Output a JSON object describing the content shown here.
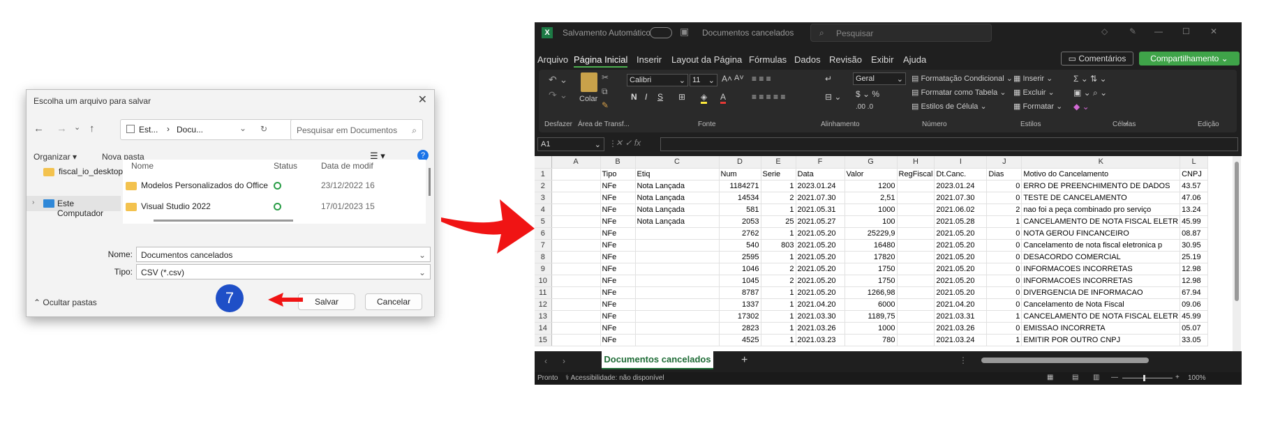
{
  "dialog": {
    "title": "Escolha um arquivo para salvar",
    "address": {
      "part1": "Est...",
      "part2": "Docu..."
    },
    "search_placeholder": "Pesquisar em Documentos",
    "toolbar": {
      "organize": "Organizar",
      "new_folder": "Nova pasta"
    },
    "nav": {
      "item1": "fiscal_io_desktop",
      "item2": "Este Computador"
    },
    "columns": {
      "name": "Nome",
      "status": "Status",
      "date": "Data de modif"
    },
    "files": [
      {
        "name": "Modelos Personalizados do Office",
        "date": "23/12/2022 16"
      },
      {
        "name": "Visual Studio 2022",
        "date": "17/01/2023 15"
      }
    ],
    "name_label": "Nome:",
    "name_value": "Documentos cancelados",
    "type_label": "Tipo:",
    "type_value": "CSV (*.csv)",
    "hide_folders": "Ocultar pastas",
    "save": "Salvar",
    "cancel": "Cancelar",
    "step": "7"
  },
  "excel": {
    "autosave": "Salvamento Automático",
    "doc_title": "Documentos cancelados",
    "search": "Pesquisar",
    "tabs": [
      "Arquivo",
      "Página Inicial",
      "Inserir",
      "Layout da Página",
      "Fórmulas",
      "Dados",
      "Revisão",
      "Exibir",
      "Ajuda"
    ],
    "comments": "Comentários",
    "share": "Compartilhamento",
    "ribbon": {
      "paste": "Colar",
      "font": "Calibri",
      "size": "11",
      "number_format": "Geral",
      "cond_format": "Formatação Condicional",
      "format_table": "Formatar como Tabela",
      "cell_styles": "Estilos de Célula",
      "insert": "Inserir",
      "delete": "Excluir",
      "format": "Formatar"
    },
    "groups": [
      "Desfazer",
      "Área de Transf...",
      "Fonte",
      "Alinhamento",
      "Número",
      "Estilos",
      "Células",
      "Edição"
    ],
    "cellref": "A1",
    "col_letters": [
      "A",
      "B",
      "C",
      "D",
      "E",
      "F",
      "G",
      "H",
      "I",
      "J",
      "K",
      "L"
    ],
    "rows": [
      [
        "",
        "Tipo",
        "Etiq",
        "Num",
        "Serie",
        "Data",
        "Valor",
        "RegFiscal",
        "Dt.Canc.",
        "Dias",
        "Motivo do Cancelamento",
        "CNPJ"
      ],
      [
        "",
        "NFe",
        "Nota Lançada",
        "1184271",
        "1",
        "2023.01.24",
        "1200",
        "",
        "2023.01.24",
        "0",
        "ERRO DE PREENCHIMENTO DE DADOS",
        "43.57"
      ],
      [
        "",
        "NFe",
        "Nota Lançada",
        "14534",
        "2",
        "2021.07.30",
        "2,51",
        "",
        "2021.07.30",
        "0",
        "TESTE DE CANCELAMENTO",
        "47.06"
      ],
      [
        "",
        "NFe",
        "Nota Lançada",
        "581",
        "1",
        "2021.05.31",
        "1000",
        "",
        "2021.06.02",
        "2",
        "nao foi a peça combinado pro serviço",
        "13.24"
      ],
      [
        "",
        "NFe",
        "Nota Lançada",
        "2053",
        "25",
        "2021.05.27",
        "100",
        "",
        "2021.05.28",
        "1",
        "CANCELAMENTO DE NOTA FISCAL ELETR",
        "45.99"
      ],
      [
        "",
        "NFe",
        "",
        "2762",
        "1",
        "2021.05.20",
        "25229,9",
        "",
        "2021.05.20",
        "0",
        "NOTA GEROU FINCANCEIRO",
        "08.87"
      ],
      [
        "",
        "NFe",
        "",
        "540",
        "803",
        "2021.05.20",
        "16480",
        "",
        "2021.05.20",
        "0",
        "Cancelamento de nota fiscal eletronica p",
        "30.95"
      ],
      [
        "",
        "NFe",
        "",
        "2595",
        "1",
        "2021.05.20",
        "17820",
        "",
        "2021.05.20",
        "0",
        "DESACORDO COMERCIAL",
        "25.19"
      ],
      [
        "",
        "NFe",
        "",
        "1046",
        "2",
        "2021.05.20",
        "1750",
        "",
        "2021.05.20",
        "0",
        "INFORMACOES INCORRETAS",
        "12.98"
      ],
      [
        "",
        "NFe",
        "",
        "1045",
        "2",
        "2021.05.20",
        "1750",
        "",
        "2021.05.20",
        "0",
        "INFORMACOES INCORRETAS",
        "12.98"
      ],
      [
        "",
        "NFe",
        "",
        "8787",
        "1",
        "2021.05.20",
        "1266,98",
        "",
        "2021.05.20",
        "0",
        "DIVERGENCIA DE INFORMACAO",
        "67.94"
      ],
      [
        "",
        "NFe",
        "",
        "1337",
        "1",
        "2021.04.20",
        "6000",
        "",
        "2021.04.20",
        "0",
        "Cancelamento de Nota Fiscal",
        "09.06"
      ],
      [
        "",
        "NFe",
        "",
        "17302",
        "1",
        "2021.03.30",
        "1189,75",
        "",
        "2021.03.31",
        "1",
        "CANCELAMENTO DE NOTA FISCAL ELETR",
        "45.99"
      ],
      [
        "",
        "NFe",
        "",
        "2823",
        "1",
        "2021.03.26",
        "1000",
        "",
        "2021.03.26",
        "0",
        "EMISSAO INCORRETA",
        "05.07"
      ],
      [
        "",
        "NFe",
        "",
        "4525",
        "1",
        "2021.03.23",
        "780",
        "",
        "2021.03.24",
        "1",
        "EMITIR POR OUTRO CNPJ",
        "33.05"
      ]
    ],
    "sheet": "Documentos cancelados",
    "status": "Pronto",
    "accessibility": "Acessibilidade: não disponível",
    "zoom": "100%"
  }
}
